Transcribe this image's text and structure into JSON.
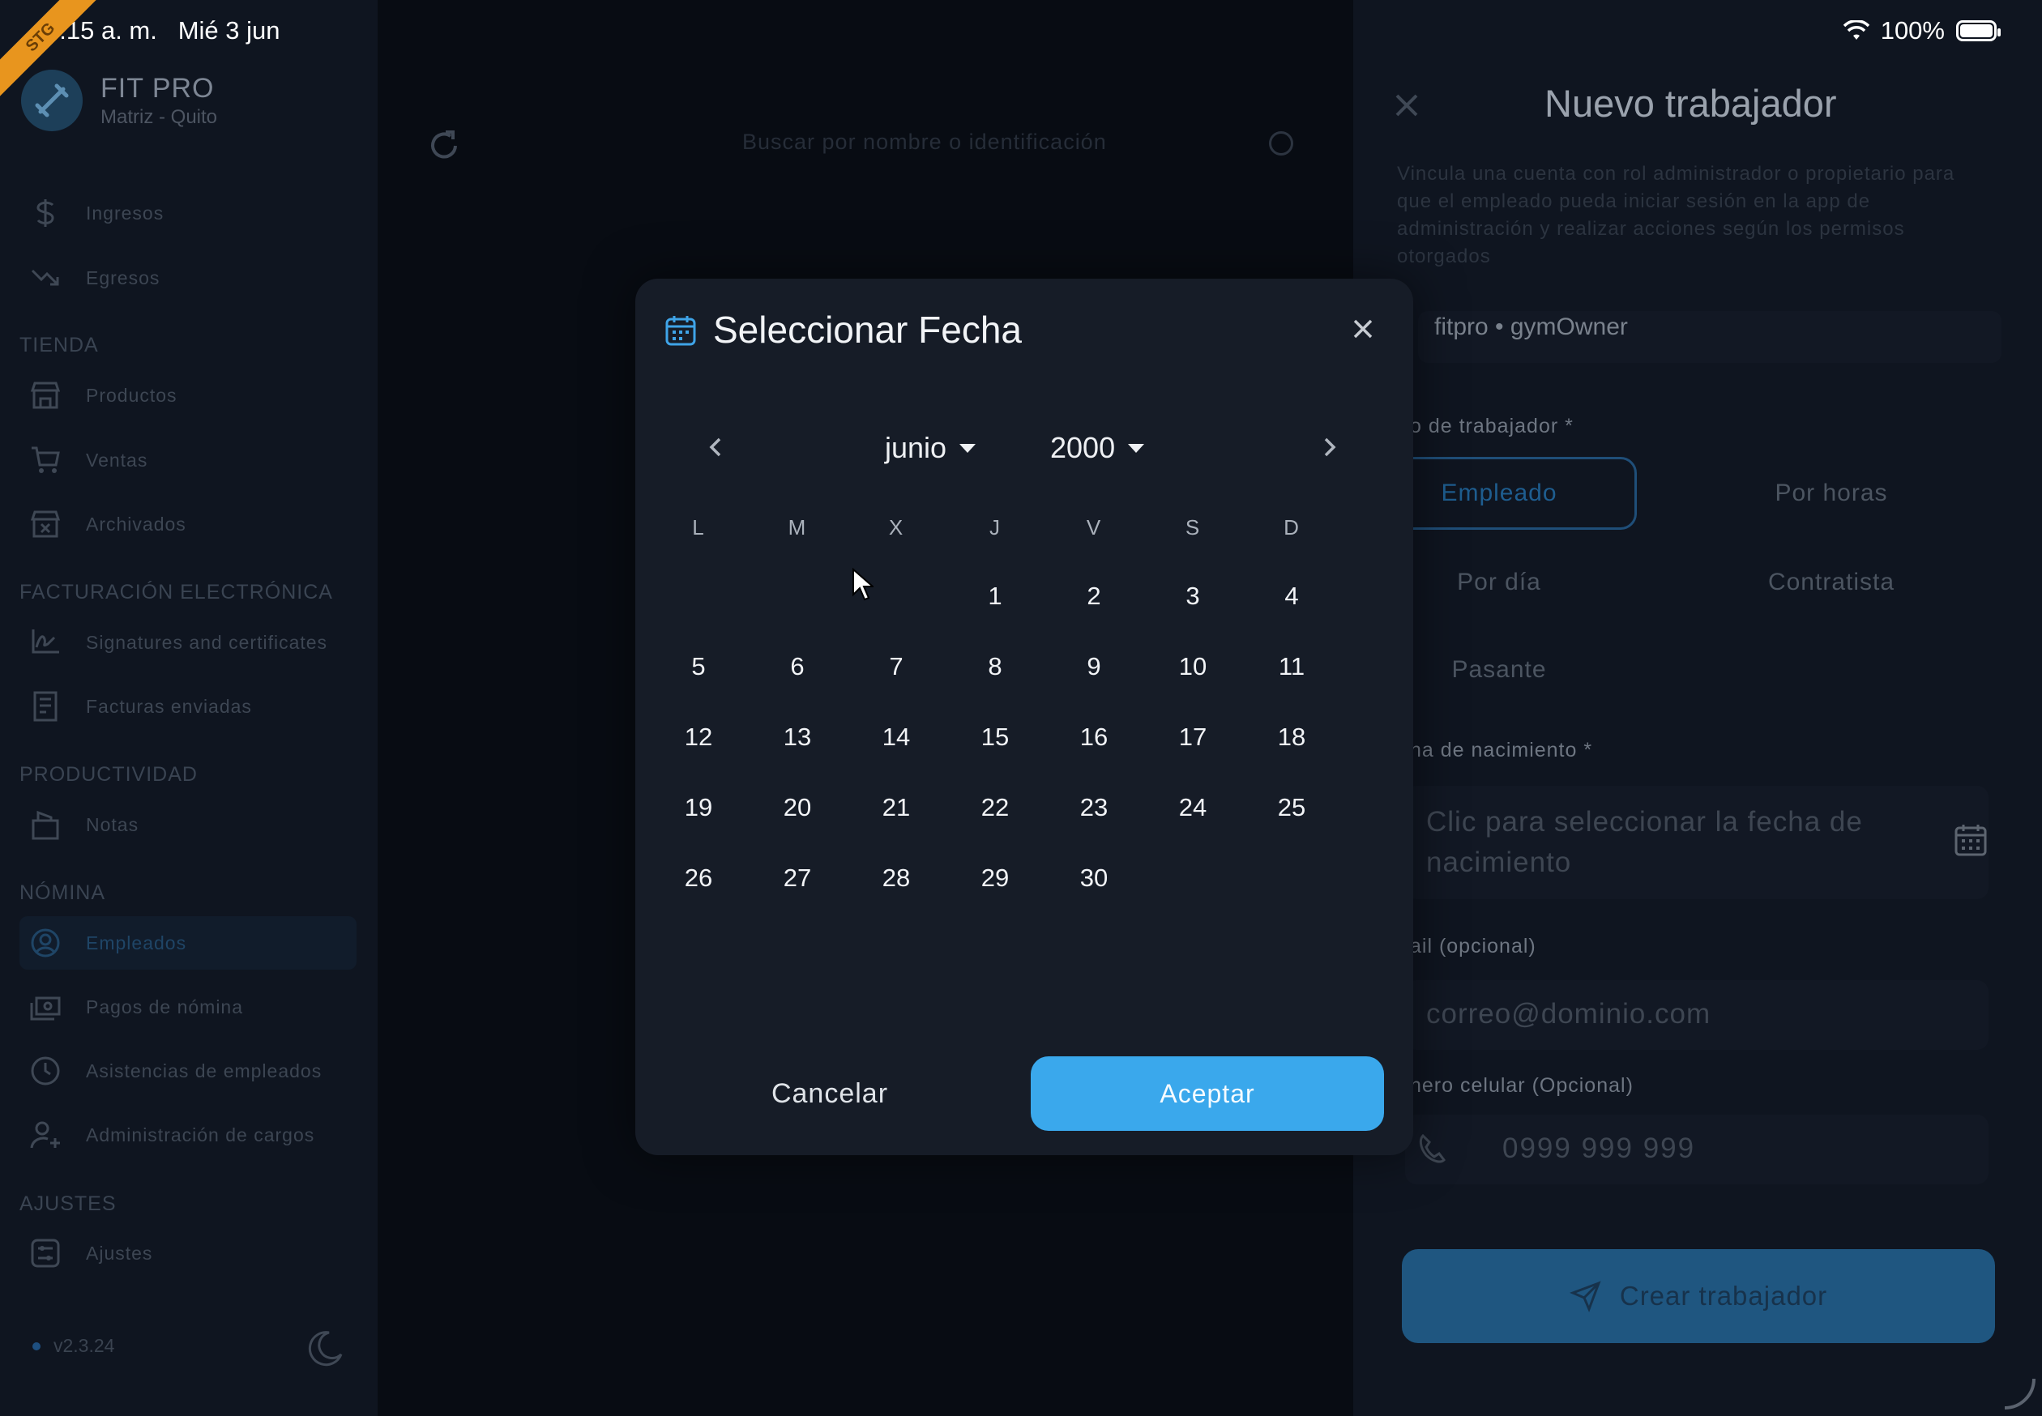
{
  "status_bar": {
    "time": "6:15 a. m.",
    "date": "Mié 3 jun",
    "battery": "100%",
    "ribbon": "STG"
  },
  "brand": {
    "name": "FIT PRO",
    "subtitle": "Matriz - Quito",
    "logo_icon": "dumbbell-icon"
  },
  "sidebar": {
    "items_top": [
      {
        "label": "Ingresos",
        "icon": "dollar-icon"
      },
      {
        "label": "Egresos",
        "icon": "trending-down-icon"
      }
    ],
    "sections": [
      {
        "title": "TIENDA",
        "items": [
          {
            "label": "Productos",
            "icon": "store-icon"
          },
          {
            "label": "Ventas",
            "icon": "cart-icon"
          },
          {
            "label": "Archivados",
            "icon": "archive-icon"
          }
        ]
      },
      {
        "title": "FACTURACIÓN ELECTRÓNICA",
        "items": [
          {
            "label": "Signatures and certificates",
            "icon": "signature-icon"
          },
          {
            "label": "Facturas enviadas",
            "icon": "invoice-icon"
          }
        ]
      },
      {
        "title": "PRODUCTIVIDAD",
        "items": [
          {
            "label": "Notas",
            "icon": "notes-icon"
          }
        ]
      },
      {
        "title": "NÓMINA",
        "items": [
          {
            "label": "Empleados",
            "icon": "user-circle-icon",
            "active": true
          },
          {
            "label": "Pagos de nómina",
            "icon": "payment-icon"
          },
          {
            "label": "Asistencias de empleados",
            "icon": "clock-icon"
          },
          {
            "label": "Administración de cargos",
            "icon": "user-cog-icon"
          }
        ]
      },
      {
        "title": "AJUSTES",
        "items": [
          {
            "label": "Ajustes",
            "icon": "settings-icon"
          }
        ]
      }
    ],
    "version": "v2.3.24"
  },
  "main": {
    "search_placeholder": "Buscar por nombre o identificación"
  },
  "panel": {
    "title": "Nuevo trabajador",
    "description": "Vincula una cuenta con rol administrador o propietario para que el empleado pueda iniciar sesión en la app de administración y realizar acciones según los permisos otorgados",
    "account": "fitpro • gymOwner",
    "type_label": "o de trabajador *",
    "types": [
      "Empleado",
      "Por horas",
      "Por día",
      "Contratista",
      "Pasante"
    ],
    "selected_type": "Empleado",
    "birth_label": "ha de nacimiento *",
    "birth_placeholder_1": "Clic para seleccionar la fecha de",
    "birth_placeholder_2": "nacimiento",
    "email_label": "ail (opcional)",
    "email_placeholder": "correo@dominio.com",
    "phone_label": "nero celular (Opcional)",
    "phone_placeholder": "0999 999 999",
    "create_button": "Crear trabajador"
  },
  "modal": {
    "title": "Seleccionar Fecha",
    "month": "junio",
    "year": "2000",
    "weekdays": [
      "L",
      "M",
      "X",
      "J",
      "V",
      "S",
      "D"
    ],
    "first_weekday_index": 3,
    "days_in_month": 30,
    "cancel": "Cancelar",
    "accept": "Aceptar",
    "accent_color": "#3aa8ec"
  }
}
